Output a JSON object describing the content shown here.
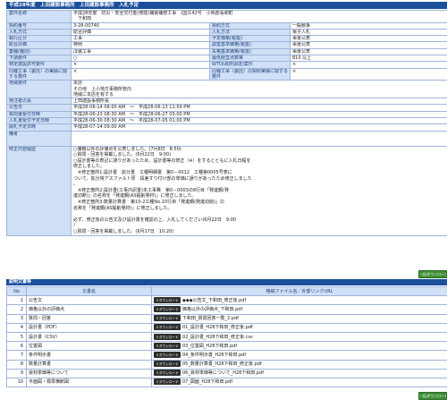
{
  "page_title": "平成28年度　上田建設事務所　上田建設事務所　入札予定",
  "info_rows": [
    {
      "type": "full",
      "label": "案件名称",
      "value": "平成28年度　防災・安全交付金(修繕)補装補修工事　(国)142号　小県郡長和町\n　下和田"
    },
    {
      "type": "pair",
      "label1": "契約番号",
      "value1": "3-28-00740",
      "label2": "契約方式",
      "value2": "一般競争"
    },
    {
      "type": "pair",
      "label1": "入札方式",
      "value1": "総合評価",
      "label2": "入札方法",
      "value2": "電子入札"
    },
    {
      "type": "pair",
      "label1": "執行区分",
      "value1": "工事",
      "label2": "予定価格(税抜)",
      "value2": "事後公表"
    },
    {
      "type": "pair",
      "label1": "総合評価",
      "value1": "特例",
      "label2": "調査基準価格(税抜)",
      "value2": "事後公表"
    },
    {
      "type": "pair",
      "label1": "業種(種別)",
      "value1": "ほ装工事",
      "label2": "失格基準価格(税抜)",
      "value2": "事後公表"
    },
    {
      "type": "pair",
      "label1": "下請要件",
      "value1": "○",
      "label2": "最低経営点数等",
      "value2": "810 以上"
    },
    {
      "type": "pair",
      "label1": "特定建設許可要件",
      "value1": "×",
      "label2": "WTO(政府調達)案件",
      "value2": "×"
    },
    {
      "type": "pair2",
      "label1": "同種工事（委託）の実績に関する要件",
      "value1": "×",
      "label2": "同種工事（委託）の契約実績に関する要件",
      "value2": "×"
    },
    {
      "type": "full",
      "label": "地域要件",
      "value": "本店\nその他　上小地方事務所管内\n地域に本店を有する"
    },
    {
      "type": "full",
      "label": "発注者の長",
      "value": "上田建設事務所長"
    },
    {
      "type": "full",
      "label": "公告日",
      "value": "平成28-06-14 08:00 AM　～　平成28-06-13 11:59 PM"
    },
    {
      "type": "full",
      "label": "質問書受付日時",
      "value": "平成28-06-23 08:30 AM　～　平成28-06-27 05:00 PM"
    },
    {
      "type": "full",
      "label": "入札書受付予定日時",
      "value": "平成28-06-30 08:30 AM　～　平成28-07-05 01:00 PM"
    },
    {
      "type": "full",
      "label": "開札予定日時",
      "value": "平成28-07-14 09:00 AM"
    },
    {
      "type": "full",
      "label": "備考",
      "value": ""
    },
    {
      "type": "big",
      "label": "修正内容履歴",
      "value": "○価格以外の評価点を公表しました。(7月8日　8:50)\n○質問・回答を掲載しました。(6月22日　9:00)\n○設計書等の表記に誤りがあったため、設計書等の修正（※）をするとともに入札日程を\n修正しました。\n　※修正箇所1:設計書　拡分書　工種明細書　第0－0012　工種第0005号表に\nついて、拡分常アスファルト厚　段差すり付け部の単価に誤りがあったため修正しました\n。\n　※修正箇所2:設計書(工事内訳書)本工事費　第0－0003の8行目「発進鋼(発\n進切断)」の名称を「発進鋼(AS掘削発材)」に修正しました。\n　※修正箇所3:数量計算書　第10-2工種No.10行目「発進鋼(発進切削)」の\n名称を「発進鋼(AS掘削発材)」に修正しました。\n\n必ず、修正後の公告文及び設計書を確認の上、入札してください(6月22日　9:00\n）\n○質問・回答を掲載しました。(6月17日　10:20)"
    }
  ],
  "docs_section_title": "説明文書等",
  "bulk_download_label": "一括ダウンロード",
  "docs_headers": {
    "no": "No",
    "name": "文書名",
    "file": "格納ファイル名／外部リンクURL"
  },
  "download_button_label": "ダウンロード",
  "documents": [
    {
      "no": "1",
      "name": "公告文",
      "file": "◆◆◆公告文_下和田_修正後.pdf"
    },
    {
      "no": "2",
      "name": "価格以外の評価点",
      "file": "価格以外の評価点_下和田.pdf"
    },
    {
      "no": "3",
      "name": "質問・回答",
      "file": "下和田_質問回答一覧_2.pdf"
    },
    {
      "no": "4",
      "name": "設計書（PDF）",
      "file": "01_設計書_H28下和田_修正後.pdf"
    },
    {
      "no": "5",
      "name": "設計書（CSV）",
      "file": "02_設計書_H28下和田_修正後.csv"
    },
    {
      "no": "6",
      "name": "位置図",
      "file": "03_位置図_H28下和田.pdf"
    },
    {
      "no": "7",
      "name": "条件明示書",
      "file": "04_条件明示書_H28下和田.pdf"
    },
    {
      "no": "8",
      "name": "数量計算書",
      "file": "05_数量計算書_H28下和田_修正後.pdf"
    },
    {
      "no": "9",
      "name": "資材単価等について",
      "file": "06_資材単価等について_H28下和田.pdf"
    },
    {
      "no": "10",
      "name": "平面図・標準横断図",
      "file": "07_図面_H28下和田.pdf"
    }
  ]
}
